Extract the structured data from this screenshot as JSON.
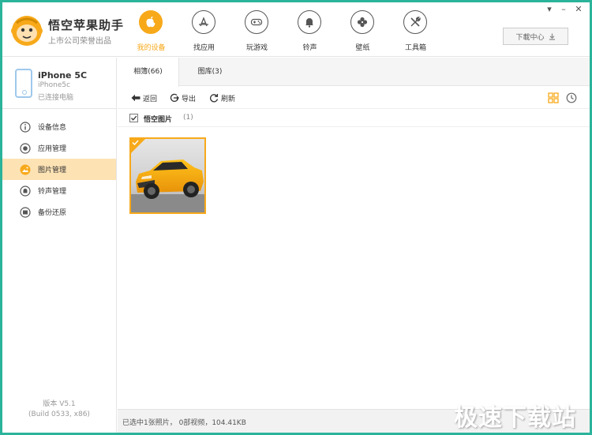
{
  "app": {
    "title": "悟空苹果助手",
    "subtitle": "上市公司荣誉出品"
  },
  "nav": [
    {
      "label": "我的设备",
      "icon": "apple-icon",
      "active": true
    },
    {
      "label": "找应用",
      "icon": "app-store-icon",
      "active": false
    },
    {
      "label": "玩游戏",
      "icon": "gamepad-icon",
      "active": false
    },
    {
      "label": "铃声",
      "icon": "bell-icon",
      "active": false
    },
    {
      "label": "壁纸",
      "icon": "clover-icon",
      "active": false
    },
    {
      "label": "工具箱",
      "icon": "tools-icon",
      "active": false
    }
  ],
  "window_controls": {
    "dropdown": "▾",
    "minimize": "–",
    "close": "✕"
  },
  "download": {
    "label": "下載中心"
  },
  "device": {
    "name": "iPhone 5C",
    "model": "iPhone5c",
    "status": "已连接电脑"
  },
  "side_menu": [
    {
      "label": "设备信息",
      "icon": "info-icon",
      "active": false
    },
    {
      "label": "应用管理",
      "icon": "app-manage-icon",
      "active": false
    },
    {
      "label": "图片管理",
      "icon": "picture-icon",
      "active": true
    },
    {
      "label": "铃声管理",
      "icon": "ringtone-icon",
      "active": false
    },
    {
      "label": "备份还原",
      "icon": "backup-icon",
      "active": false
    }
  ],
  "version": {
    "line1": "版本 V5.1",
    "line2": "(Build 0533, x86)"
  },
  "tabs": [
    {
      "label": "相簿(66)",
      "active": true
    },
    {
      "label": "图库(3)",
      "active": false
    }
  ],
  "toolbar": {
    "back": "返回",
    "export": "导出",
    "refresh": "刷新"
  },
  "album": {
    "name": "悟空图片",
    "count": "(1)",
    "checked": true
  },
  "status": {
    "text": "已选中1张照片， 0部视频，104.41KB"
  },
  "watermark": "极速下载站",
  "colors": {
    "accent": "#f7a91a",
    "frame": "#2bb39b",
    "active_side": "#fde2b4"
  }
}
